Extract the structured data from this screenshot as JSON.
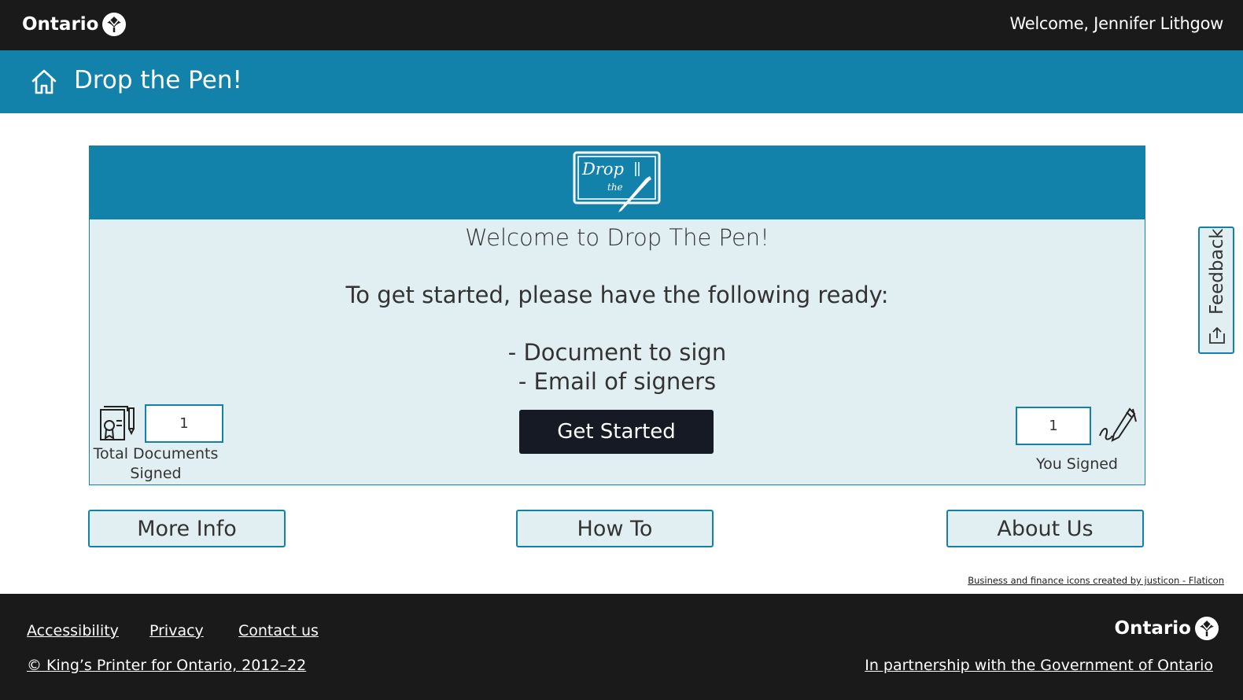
{
  "header": {
    "brand": "Ontario",
    "welcome": "Welcome, Jennifer Lithgow"
  },
  "titlebar": {
    "title": "Drop the Pen!"
  },
  "panel": {
    "logo_text_line1": "Drop",
    "logo_text_line2": "the",
    "heading": "Welcome to Drop The Pen!",
    "ready_text": "To get started, please have the following ready:",
    "requirements": [
      "- Document to sign",
      "- Email of signers"
    ],
    "get_started_label": "Get Started",
    "total_signed_value": "1",
    "total_signed_label": "Total Documents Signed",
    "you_signed_value": "1",
    "you_signed_label": "You Signed"
  },
  "buttons": {
    "more_info": "More Info",
    "how_to": "How To",
    "about_us": "About Us"
  },
  "attribution": "Business and finance icons created by justicon - Flaticon",
  "feedback": {
    "label": "Feedback"
  },
  "footer": {
    "accessibility": "Accessibility",
    "privacy": "Privacy",
    "contact": "Contact us",
    "copyright": "© King’s Printer for Ontario, 2012–22",
    "partnership": "In partnership with the Government of Ontario",
    "brand": "Ontario"
  },
  "colors": {
    "topbar": "#1a1a1a",
    "accent": "#1382aa",
    "panel_bg": "#e1eff2",
    "primary_button": "#161a24"
  }
}
